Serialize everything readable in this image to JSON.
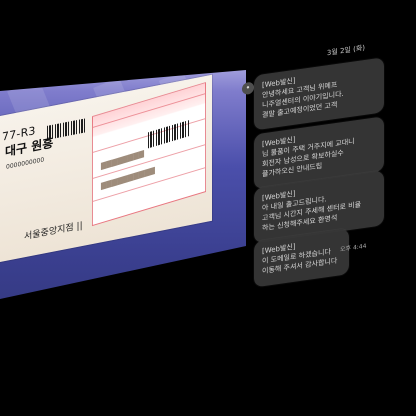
{
  "photo": {
    "label_top": "77-R3",
    "label_big": "대구 원흥",
    "label_bottom": "서울중앙지점 ||",
    "hidden_text_1": "0000000000"
  },
  "chat": {
    "date": "3월 2일 (화)",
    "avatar_icon": "avatar-icon",
    "time": "오후 4:44",
    "messages": [
      {
        "lines": [
          "[Web발신]",
          "안녕하세요 고객님 위메프",
          "니주얼센터의 이야기입니다.",
          "결말 출고예정이었던 고객"
        ]
      },
      {
        "lines": [
          "[Web발신]",
          "님 물품이 주택 거주지에 교대니",
          "회전자 남성으로 확보하실수",
          "플가하오신 안내드립"
        ]
      },
      {
        "lines": [
          "[Web발신]",
          "아 내일 출고드립니다.",
          "고객님 시간지 주세해 센터로 비율",
          "하는 신청해주세요 환영석"
        ]
      },
      {
        "lines": [
          "[Web발신]",
          "이 도메일로 하겠습니다",
          "이동해 주셔서 감사합니다"
        ]
      }
    ]
  }
}
